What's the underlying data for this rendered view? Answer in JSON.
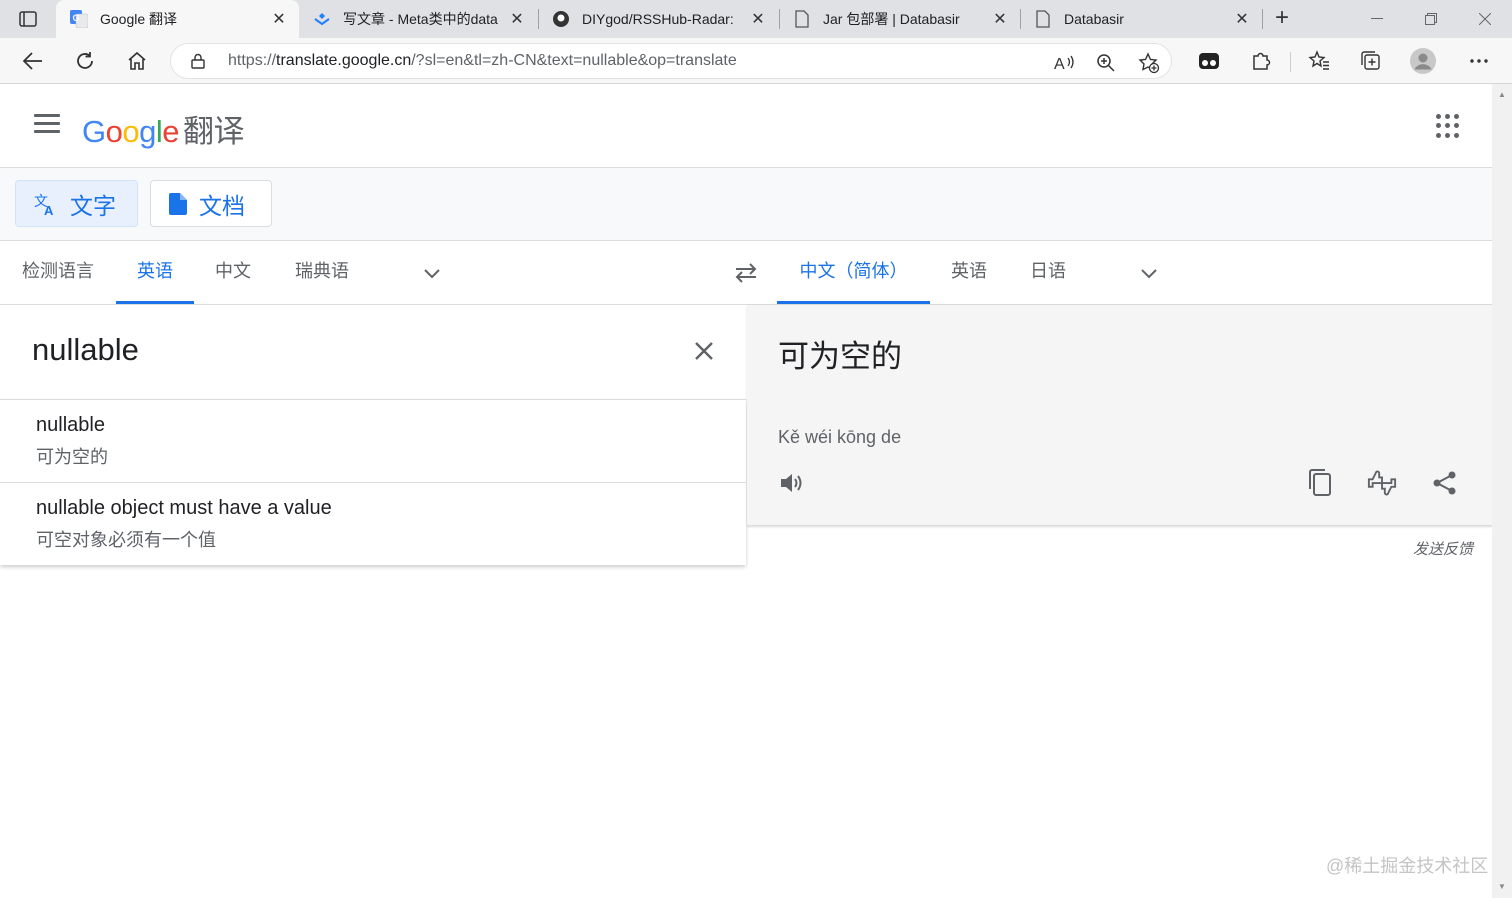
{
  "browser": {
    "tabs": [
      {
        "title": "Google 翻译",
        "active": true,
        "icon": "google-translate-favicon"
      },
      {
        "title": "写文章 - Meta类中的data",
        "active": false,
        "icon": "juejin-favicon"
      },
      {
        "title": "DIYgod/RSSHub-Radar:",
        "active": false,
        "icon": "github-favicon"
      },
      {
        "title": "Jar 包部署 | Databasir",
        "active": false,
        "icon": "page-favicon"
      },
      {
        "title": "Databasir",
        "active": false,
        "icon": "page-favicon"
      }
    ],
    "url_prefix": "https://",
    "url_host": "translate.google.cn",
    "url_path": "/?sl=en&tl=zh-CN&text=nullable&op=translate"
  },
  "app": {
    "logo_product": "翻译",
    "modes": [
      {
        "label": "文字",
        "icon": "translate-icon",
        "active": true
      },
      {
        "label": "文档",
        "icon": "document-icon",
        "active": false
      }
    ],
    "source_langs": [
      "检测语言",
      "英语",
      "中文",
      "瑞典语"
    ],
    "source_selected": 1,
    "target_langs": [
      "中文（简体）",
      "英语",
      "日语"
    ],
    "target_selected": 0
  },
  "source": {
    "text": "nullable",
    "suggestions": [
      {
        "en": "nullable",
        "zh": "可为空的"
      },
      {
        "en": "nullable object must have a value",
        "zh": "可空对象必须有一个值"
      }
    ]
  },
  "target": {
    "text": "可为空的",
    "romanization": "Kě wéi kōng de"
  },
  "feedback_label": "发送反馈",
  "watermark": "@稀土掘金技术社区",
  "colors": {
    "accent": "#1a73e8",
    "tabbar": "#dfe1e5",
    "target_bg": "#f5f5f5"
  }
}
